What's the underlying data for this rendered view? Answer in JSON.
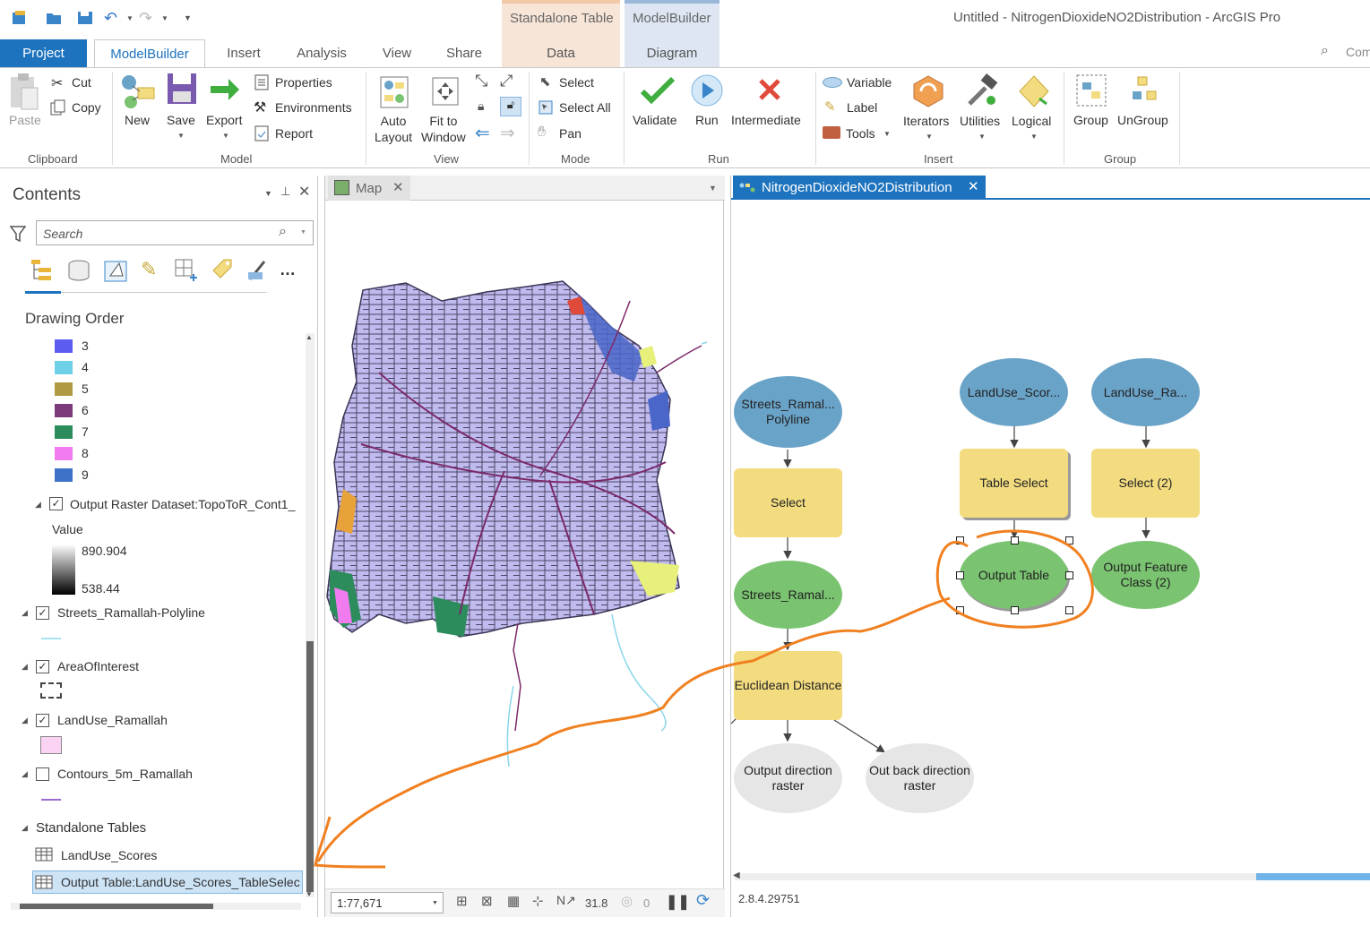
{
  "app": {
    "title": "Untitled - NitrogenDioxideNO2Distribution - ArcGIS Pro",
    "search_placeholder": "Com"
  },
  "context_tabs": [
    {
      "group": "Standalone Table",
      "tab": "Data"
    },
    {
      "group": "ModelBuilder",
      "tab": "Diagram"
    }
  ],
  "tabs": [
    "Project",
    "ModelBuilder",
    "Insert",
    "Analysis",
    "View",
    "Share"
  ],
  "ribbon": {
    "clipboard": {
      "paste": "Paste",
      "cut": "Cut",
      "copy": "Copy",
      "group": "Clipboard"
    },
    "model": {
      "new": "New",
      "save": "Save",
      "export": "Export",
      "properties": "Properties",
      "environments": "Environments",
      "report": "Report",
      "group": "Model"
    },
    "view": {
      "auto_layout": "Auto Layout",
      "auto_layout_1": "Auto",
      "auto_layout_2": "Layout",
      "fit_1": "Fit to",
      "fit_2": "Window",
      "group": "View"
    },
    "mode": {
      "select": "Select",
      "select_all": "Select All",
      "pan": "Pan",
      "group": "Mode"
    },
    "run": {
      "validate": "Validate",
      "run": "Run",
      "intermediate": "Intermediate",
      "group": "Run"
    },
    "insert": {
      "variable": "Variable",
      "label": "Label",
      "tools": "Tools",
      "iterators": "Iterators",
      "utilities": "Utilities",
      "logical": "Logical",
      "group": "Insert"
    },
    "group": {
      "group": "Group",
      "ungroup": "UnGroup",
      "group_label": "Group"
    }
  },
  "contents": {
    "title": "Contents",
    "search_placeholder": "Search",
    "drawing_order": "Drawing Order",
    "legend": [
      {
        "label": "3",
        "color": "#5c5cf0"
      },
      {
        "label": "4",
        "color": "#6ed0e6"
      },
      {
        "label": "5",
        "color": "#b09a44"
      },
      {
        "label": "6",
        "color": "#7b3a7a"
      },
      {
        "label": "7",
        "color": "#2c8c5c"
      },
      {
        "label": "8",
        "color": "#f07cf0"
      },
      {
        "label": "9",
        "color": "#3e72c8"
      }
    ],
    "raster_layer": "Output Raster Dataset:TopoToR_Cont1_",
    "value_label": "Value",
    "value_high": "890.904",
    "value_low": "538.44",
    "layers": [
      {
        "label": "Streets_Ramallah-Polyline",
        "checked": true
      },
      {
        "label": "AreaOfInterest",
        "checked": true
      },
      {
        "label": "LandUse_Ramallah",
        "checked": true
      },
      {
        "label": "Contours_5m_Ramallah",
        "checked": false
      }
    ],
    "standalone_tables": "Standalone Tables",
    "tables": [
      "LandUse_Scores",
      "Output Table:LandUse_Scores_TableSelec"
    ]
  },
  "map": {
    "tab": "Map",
    "scale": "1:77,671",
    "status_a": "31.8",
    "status_b": "0"
  },
  "diagram": {
    "tab": "NitrogenDioxideNO2Distribution",
    "version": "2.8.4.29751",
    "nodes": {
      "streets_in": "Streets_Ramal... Polyline",
      "select": "Select",
      "streets_out": "Streets_Ramal...",
      "euclidean": "Euclidean Distance",
      "out_dir": "Output direction raster",
      "out_back": "Out back direction raster",
      "landuse_scores": "LandUse_Scor...",
      "table_select": "Table Select",
      "output_table": "Output Table",
      "landuse_ra": "LandUse_Ra...",
      "select2": "Select (2)",
      "output_fc2": "Output Feature Class (2)"
    }
  },
  "colors": {
    "accent": "#1e73be",
    "annotation": "#f08020"
  }
}
